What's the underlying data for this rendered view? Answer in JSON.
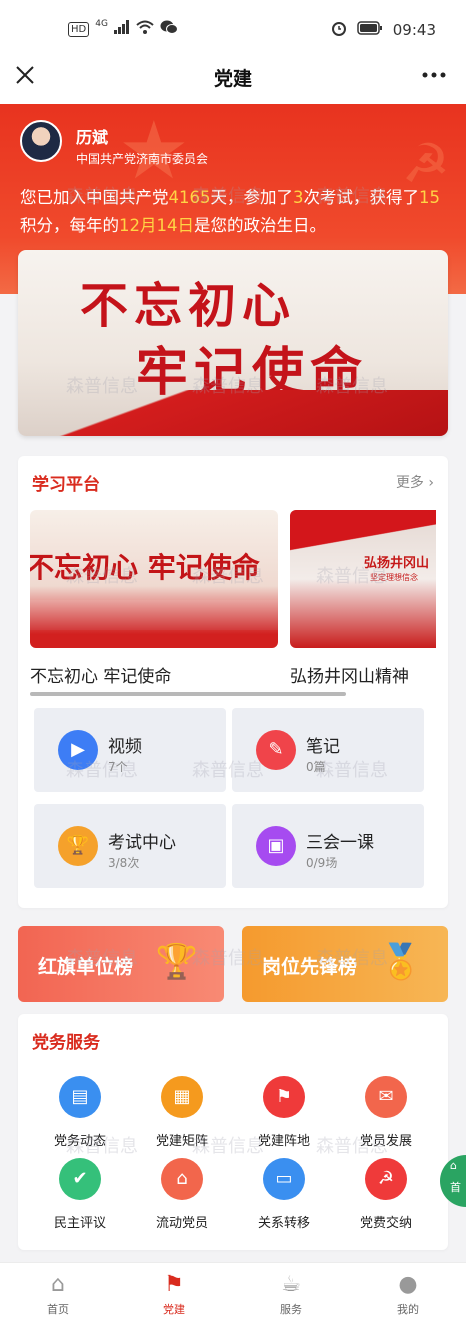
{
  "status_bar": {
    "left_icons": [
      "HD",
      "4G",
      "signal-icon",
      "wifi-icon",
      "wechat-icon"
    ],
    "time": "09:43",
    "right_icons": [
      "alarm-icon",
      "battery-icon"
    ]
  },
  "header": {
    "title": "党建",
    "close_icon": "close-icon",
    "more_icon": "more-icon"
  },
  "profile": {
    "name": "历斌",
    "org": "中国共产党济南市委员会"
  },
  "summary": {
    "p1": "您已加入中国共产党",
    "days": "4165",
    "p2": "天，参加了",
    "exams": "3",
    "p3": "次考试，获得了",
    "points": "15",
    "p4": "积分，每年的",
    "birthday": "12月14日",
    "p5": "是您的政治生日。"
  },
  "banner": {
    "line1": "不忘初心",
    "line2": "牢记使命"
  },
  "learning": {
    "title": "学习平台",
    "more": "更多",
    "slides": [
      {
        "image_text": "不忘初心 牢记使命",
        "caption": "不忘初心 牢记使命"
      },
      {
        "image_text": "弘扬井冈山",
        "image_sub": "坚定理想信念",
        "caption": "弘扬井冈山精神"
      }
    ],
    "tiles": [
      {
        "label": "视频",
        "count": "7个",
        "icon": "video-icon",
        "color": "#3d7df5"
      },
      {
        "label": "笔记",
        "count": "0篇",
        "icon": "note-icon",
        "color": "#f0444a"
      },
      {
        "label": "考试中心",
        "count": "3/8次",
        "icon": "trophy-icon",
        "color": "#f5a12b"
      },
      {
        "label": "三会一课",
        "count": "0/9场",
        "icon": "meeting-icon",
        "color": "#a64bf0"
      }
    ]
  },
  "rankings": [
    {
      "label": "红旗单位榜",
      "color": "#f3604c"
    },
    {
      "label": "岗位先锋榜",
      "color": "#f59a2e"
    }
  ],
  "services": {
    "title": "党务服务",
    "items": [
      {
        "label": "党务动态",
        "icon": "news-icon",
        "color": "#3a8ff0"
      },
      {
        "label": "党建矩阵",
        "icon": "grid-icon",
        "color": "#f59a1e"
      },
      {
        "label": "党建阵地",
        "icon": "flag-icon",
        "color": "#ef3a3a"
      },
      {
        "label": "党员发展",
        "icon": "mail-icon",
        "color": "#f2664c"
      },
      {
        "label": "民主评议",
        "icon": "vote-icon",
        "color": "#35c07a"
      },
      {
        "label": "流动党员",
        "icon": "home-icon",
        "color": "#f2664c"
      },
      {
        "label": "关系转移",
        "icon": "card-icon",
        "color": "#3a8ff0"
      },
      {
        "label": "党费交纳",
        "icon": "party-emblem-icon",
        "color": "#ef3a3a"
      }
    ]
  },
  "float_button": {
    "label": "首"
  },
  "tabbar": {
    "items": [
      {
        "label": "首页",
        "icon": "home-icon"
      },
      {
        "label": "党建",
        "icon": "party-flag-icon",
        "active": true
      },
      {
        "label": "服务",
        "icon": "coffee-icon"
      },
      {
        "label": "我的",
        "icon": "user-icon"
      }
    ]
  },
  "watermark": "森普信息"
}
